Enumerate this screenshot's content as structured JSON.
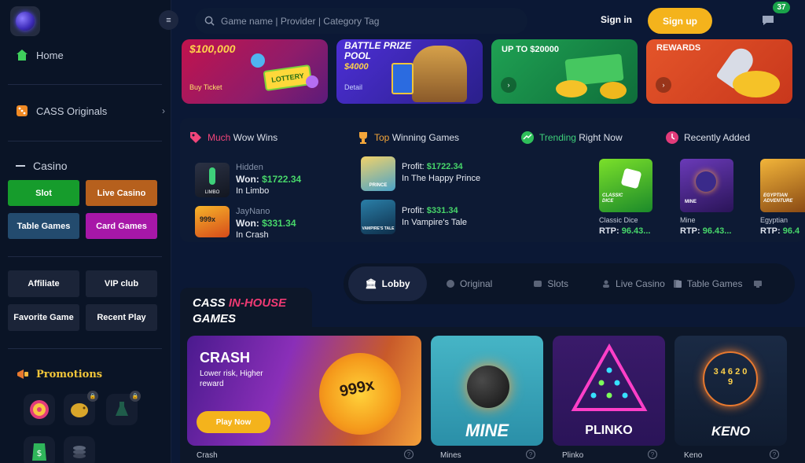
{
  "header": {
    "search_placeholder": "Game name | Provider | Category Tag",
    "signin_label": "Sign in",
    "signup_label": "Sign up",
    "notification_count": "37"
  },
  "sidebar": {
    "home": "Home",
    "originals": "CASS Originals",
    "casino": "Casino",
    "casino_buttons": [
      "Slot",
      "Live Casino",
      "Table Games",
      "Card Games"
    ],
    "extra_buttons": [
      "Affiliate",
      "VIP club",
      "Favorite Game",
      "Recent Play"
    ],
    "promotions": "Promotions"
  },
  "banners": [
    {
      "title": "$100,000",
      "sub": "Buy Ticket",
      "badge": "LOTTERY"
    },
    {
      "title": "BATTLE PRIZE POOL",
      "amount": "$4000",
      "sub": "Detail"
    },
    {
      "title": "UP TO $20000"
    },
    {
      "title": "REWARDS"
    }
  ],
  "wins": {
    "headers": [
      {
        "highlight": "Much",
        "rest": " Wow Wins"
      },
      {
        "highlight": "Top",
        "rest": " Winning Games"
      },
      {
        "highlight": "Trending",
        "rest": " Right Now"
      },
      {
        "highlight": "",
        "rest": "Recently Added"
      }
    ],
    "much_wow": [
      {
        "user": "Hidden",
        "won_label": "Won:",
        "amount": "$1722.34",
        "game": "In Limbo",
        "thumb_text": "LIMBO"
      },
      {
        "user": "JayNano",
        "won_label": "Won:",
        "amount": "$331.34",
        "game": "In Crash",
        "thumb_text": "999x"
      }
    ],
    "top_games": [
      {
        "profit_label": "Profit:",
        "amount": "$1722.34",
        "game": "In The Happy Prince",
        "thumb_text": "PRINCE"
      },
      {
        "profit_label": "Profit:",
        "amount": "$331.34",
        "game": "In Vampire's Tale",
        "thumb_text": "VAMPIRE'S TALE"
      }
    ],
    "recent": [
      {
        "name": "Classic Dice",
        "rtp_label": "RTP:",
        "rtp": "96.43...",
        "thumb_text": "CLASSIC DICE"
      },
      {
        "name": "Mine",
        "rtp_label": "RTP:",
        "rtp": "96.43...",
        "thumb_text": "MINE"
      },
      {
        "name": "Egyptian",
        "rtp_label": "RTP:",
        "rtp": "96.4",
        "thumb_text": "EGYPTIAN ADVENTURE"
      }
    ]
  },
  "tabs": [
    "Lobby",
    "Original",
    "Slots",
    "Live Casino",
    "Table Games"
  ],
  "inhouse": {
    "prefix": "CASS ",
    "highlight": "IN-HOUSE",
    "line2": "GAMES"
  },
  "games": [
    {
      "title": "CRASH",
      "desc": "Lower risk, Higher reward",
      "cta": "Play Now",
      "label": "Crash",
      "art_text": "999x"
    },
    {
      "title": "MINE",
      "label": "Mines"
    },
    {
      "title": "PLINKO",
      "label": "Plinko"
    },
    {
      "title": "KENO",
      "label": "Keno",
      "art_text": "3 4 6 2 0 9"
    }
  ],
  "colors": {
    "accent": "#f4b31c",
    "background": "#0b1835",
    "win_green": "#47d66a",
    "highlight_pink": "#f0457a"
  }
}
